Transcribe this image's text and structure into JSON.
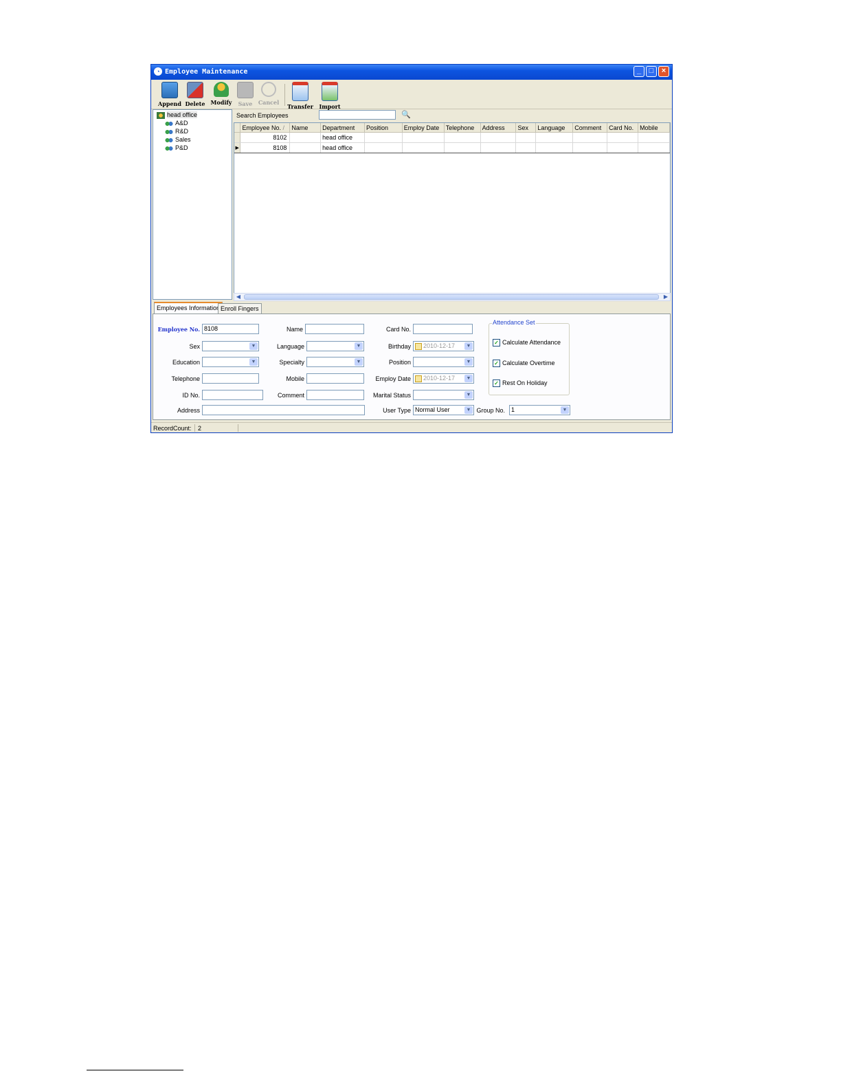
{
  "window": {
    "title": "Employee Maintenance"
  },
  "toolbar": {
    "append": "Append",
    "delete": "Delete",
    "modify": "Modify",
    "save": "Save",
    "cancel": "Cancel",
    "transfer": "Transfer",
    "import": "Import"
  },
  "tree": {
    "root": "head office",
    "children": [
      "A&D",
      "R&D",
      "Sales",
      "P&D"
    ]
  },
  "search": {
    "label": "Search Employees",
    "value": ""
  },
  "grid": {
    "columns": [
      "Employee No.",
      "Name",
      "Department",
      "Position",
      "Employ Date",
      "Telephone",
      "Address",
      "Sex",
      "Language",
      "Comment",
      "Card No.",
      "Mobile"
    ],
    "sort_indicator": "/",
    "rows": [
      {
        "emp_no": "8102",
        "department": "head office"
      },
      {
        "emp_no": "8108",
        "department": "head office"
      }
    ],
    "current_row_marker": "▶"
  },
  "tabs": [
    "Employees Information",
    "Enroll Fingers"
  ],
  "form": {
    "employee_no": {
      "label": "Employee No.",
      "value": "8108"
    },
    "name": {
      "label": "Name",
      "value": ""
    },
    "card_no": {
      "label": "Card No.",
      "value": ""
    },
    "sex": {
      "label": "Sex",
      "value": ""
    },
    "language": {
      "label": "Language",
      "value": ""
    },
    "birthday": {
      "label": "Birthday",
      "value": "2010-12-17"
    },
    "education": {
      "label": "Education",
      "value": ""
    },
    "specialty": {
      "label": "Specialty",
      "value": ""
    },
    "position": {
      "label": "Position",
      "value": ""
    },
    "telephone": {
      "label": "Telephone",
      "value": ""
    },
    "mobile": {
      "label": "Mobile",
      "value": ""
    },
    "employ_date": {
      "label": "Employ Date",
      "value": "2010-12-17"
    },
    "id_no": {
      "label": "ID No.",
      "value": ""
    },
    "comment": {
      "label": "Comment",
      "value": ""
    },
    "marital_status": {
      "label": "Marital Status",
      "value": ""
    },
    "address": {
      "label": "Address",
      "value": ""
    },
    "user_type": {
      "label": "User Type",
      "value": "Normal User"
    },
    "group_no": {
      "label": "Group No.",
      "value": "1"
    }
  },
  "attendance": {
    "label": "Attendance Set",
    "calc_attendance": "Calculate Attendance",
    "calc_overtime": "Calculate Overtime",
    "rest_on_holiday": "Rest On Holiday",
    "checkmark": "✓"
  },
  "status": {
    "record_count_label": "RecordCount:",
    "record_count": "2"
  },
  "icons": {
    "append": "append-icon",
    "delete": "delete-icon",
    "modify": "modify-icon",
    "save": "save-icon",
    "cancel": "cancel-icon",
    "transfer": "transfer-icon",
    "import": "import-icon",
    "search": "search-icon",
    "department": "department-icon"
  },
  "colors": {
    "titlebar": "#0d55e0",
    "required_label": "#2233cc",
    "tab_accent": "#e68b2c"
  }
}
